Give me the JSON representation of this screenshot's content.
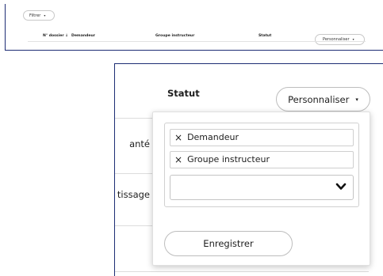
{
  "mini": {
    "filter_label": "Filtrer",
    "filter_caret": "▾",
    "headers": {
      "dossier": "N° dossier ↓",
      "demandeur": "Demandeur",
      "groupe": "Groupe instructeur",
      "statut": "Statut"
    },
    "customize_label": "Personnaliser",
    "customize_caret": "▾"
  },
  "zoom": {
    "statut_header": "Statut",
    "customize_label": "Personnaliser",
    "customize_caret": "▾",
    "rows": [
      {
        "text": "anté"
      },
      {
        "text": "tissage"
      }
    ],
    "dropdown": {
      "tags": [
        {
          "remove": "×",
          "label": "Demandeur"
        },
        {
          "remove": "×",
          "label": "Groupe instructeur"
        }
      ],
      "combo_value": "",
      "combo_icon": "chevron-down-icon",
      "save_label": "Enregistrer"
    }
  }
}
